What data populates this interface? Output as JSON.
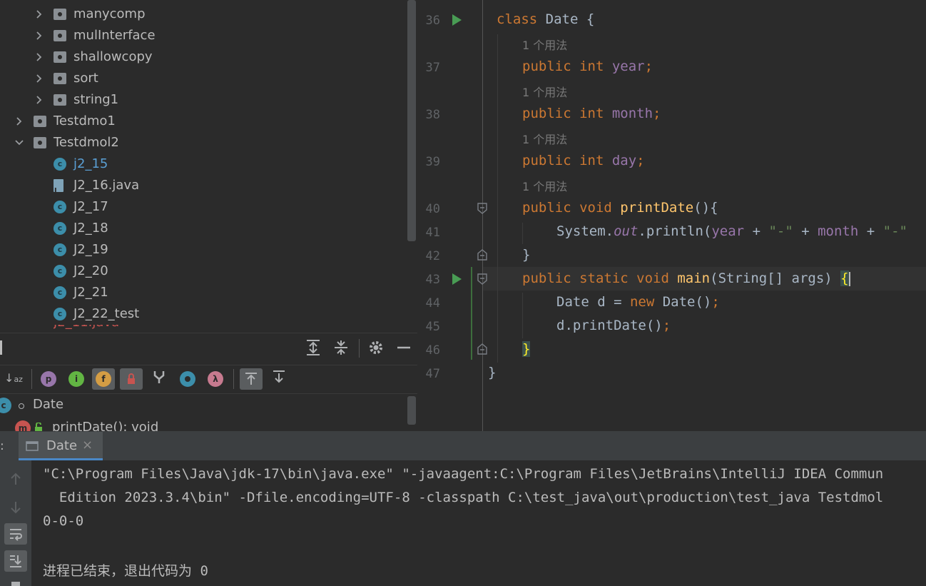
{
  "project_tree": {
    "items": [
      {
        "label": "manycomp",
        "type": "package",
        "level": 2,
        "expanded": false
      },
      {
        "label": "mulInterface",
        "type": "package",
        "level": 2,
        "expanded": false
      },
      {
        "label": "shallowcopy",
        "type": "package",
        "level": 2,
        "expanded": false
      },
      {
        "label": "sort",
        "type": "package",
        "level": 2,
        "expanded": false
      },
      {
        "label": "string1",
        "type": "package",
        "level": 2,
        "expanded": false
      },
      {
        "label": "Testdmo1",
        "type": "package",
        "level": 1,
        "expanded": false
      },
      {
        "label": "Testdmol2",
        "type": "package",
        "level": 1,
        "expanded": true
      },
      {
        "label": "j2_15",
        "type": "class",
        "level": 2,
        "selected": true
      },
      {
        "label": "J2_16.java",
        "type": "java-file",
        "level": 2
      },
      {
        "label": "J2_17",
        "type": "class",
        "level": 2
      },
      {
        "label": "J2_18",
        "type": "class",
        "level": 2
      },
      {
        "label": "J2_19",
        "type": "class",
        "level": 2
      },
      {
        "label": "J2_20",
        "type": "class",
        "level": 2
      },
      {
        "label": "J2_21",
        "type": "class",
        "level": 2
      },
      {
        "label": "J2_22_test",
        "type": "class",
        "level": 2
      }
    ]
  },
  "structure": {
    "root_label": "Date",
    "member_label": "printDate(): void",
    "filter_icons": [
      "sort-alpha-icon",
      "property-icon",
      "inherited-icon",
      "field-icon",
      "lock-icon",
      "branch-icon",
      "anonymous-icon",
      "lambda-icon",
      "expand-up-icon",
      "expand-down-icon"
    ]
  },
  "editor": {
    "usage_hint": "1 个用法",
    "lines": [
      {
        "no": "36",
        "run": true
      },
      {
        "no": "37"
      },
      {
        "no": "38"
      },
      {
        "no": "39"
      },
      {
        "no": "40"
      },
      {
        "no": "41"
      },
      {
        "no": "42"
      },
      {
        "no": "43",
        "run": true
      },
      {
        "no": "44"
      },
      {
        "no": "45"
      },
      {
        "no": "46"
      },
      {
        "no": "47"
      }
    ]
  },
  "run_panel": {
    "tab_prefix": ":",
    "tab_label": "Date",
    "tab_close": "×",
    "output": [
      "\"C:\\Program Files\\Java\\jdk-17\\bin\\java.exe\" \"-javaagent:C:\\Program Files\\JetBrains\\IntelliJ IDEA Commun",
      "  Edition 2023.3.4\\bin\" -Dfile.encoding=UTF-8 -classpath C:\\test_java\\out\\production\\test_java Testdmol",
      "0-0-0",
      "",
      "进程已结束，退出代码为 0"
    ]
  },
  "colors": {
    "background": "#2b2b2b",
    "panel": "#3c3f41",
    "keyword": "#cc7832",
    "field": "#9876aa",
    "method": "#ffc66d",
    "string": "#6a8759",
    "run_green": "#499c54",
    "class_icon": "#3c8eaa"
  }
}
